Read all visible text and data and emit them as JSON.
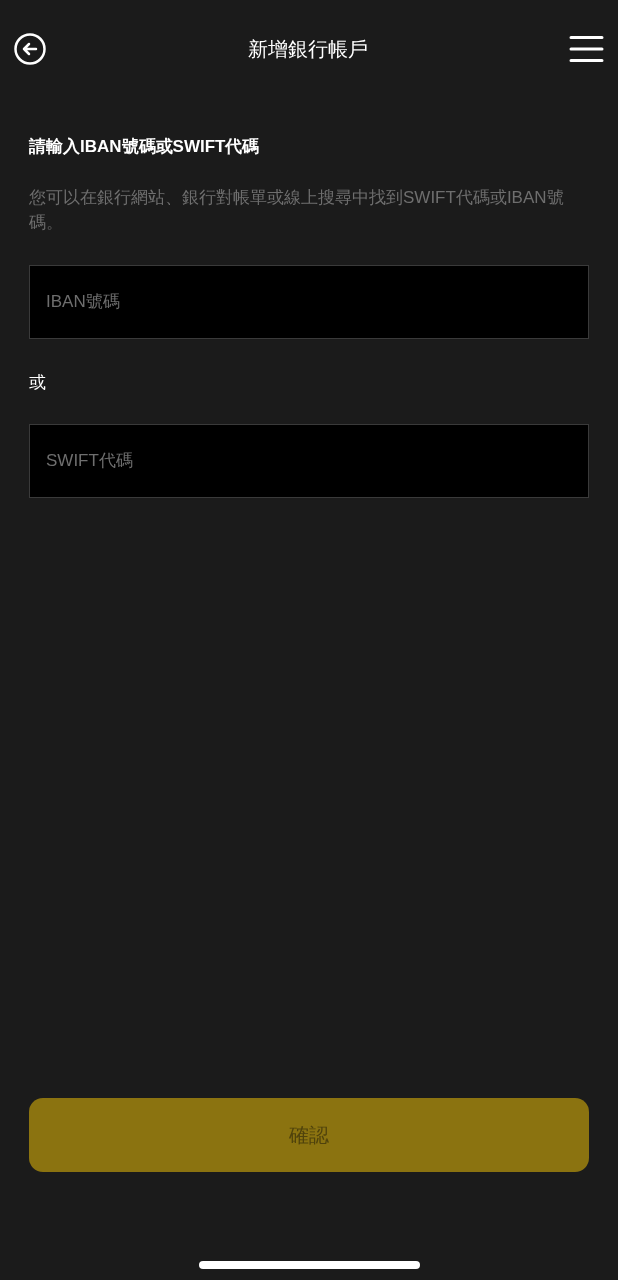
{
  "header": {
    "title": "新增銀行帳戶"
  },
  "heading": "請輸入IBAN號碼或SWIFT代碼",
  "description": "您可以在銀行網站、銀行對帳單或線上搜尋中找到SWIFT代碼或IBAN號碼。",
  "fields": [
    {
      "placeholder": "IBAN號碼"
    },
    {
      "placeholder": "SWIFT代碼"
    }
  ],
  "separator": "或",
  "confirm_button": {
    "label": "確認",
    "disabled": true
  }
}
